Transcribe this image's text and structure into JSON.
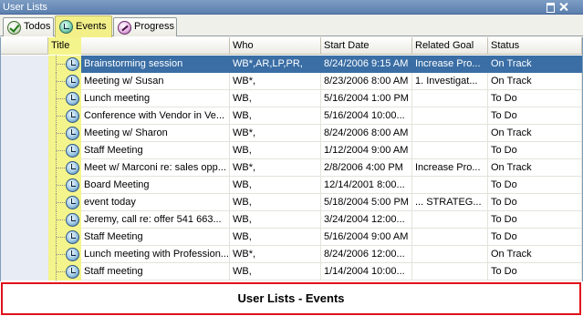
{
  "window": {
    "title": "User Lists"
  },
  "tabs": [
    {
      "label": "Todos",
      "icon": "check-icon"
    },
    {
      "label": "Events",
      "icon": "clock-icon",
      "active": true
    },
    {
      "label": "Progress",
      "icon": "progress-icon"
    }
  ],
  "columns": {
    "title": "Title",
    "who": "Who",
    "start": "Start Date",
    "goal": "Related Goal",
    "status": "Status"
  },
  "rows": [
    {
      "title": "Brainstorming session",
      "who": "WB*,AR,LP,PR,",
      "start": "8/24/2006 9:15 AM",
      "goal": "Increase Pro...",
      "status": "On Track",
      "selected": true
    },
    {
      "title": "Meeting w/ Susan",
      "who": "WB*,",
      "start": "8/23/2006 8:00 AM",
      "goal": "1. Investigat...",
      "status": "On Track"
    },
    {
      "title": "Lunch meeting",
      "who": "WB,",
      "start": "5/16/2004 1:00 PM",
      "goal": "",
      "status": "To Do"
    },
    {
      "title": "Conference with Vendor in Ve...",
      "who": "WB,",
      "start": "5/16/2004 10:00...",
      "goal": "",
      "status": "To Do"
    },
    {
      "title": "Meeting w/ Sharon",
      "who": "WB*,",
      "start": "8/24/2006 8:00 AM",
      "goal": "",
      "status": "On Track"
    },
    {
      "title": "Staff Meeting",
      "who": "WB,",
      "start": "1/12/2004 9:00 AM",
      "goal": "",
      "status": "To Do"
    },
    {
      "title": "Meet w/ Marconi re: sales opp...",
      "who": "WB*,",
      "start": "2/8/2006 4:00 PM",
      "goal": "Increase Pro...",
      "status": "On Track"
    },
    {
      "title": "Board Meeting",
      "who": "WB,",
      "start": "12/14/2001 8:00...",
      "goal": "",
      "status": "To Do"
    },
    {
      "title": "event today",
      "who": "WB,",
      "start": "5/18/2004 5:00 PM",
      "goal": "... STRATEG...",
      "status": "To Do"
    },
    {
      "title": "Jeremy, call re: offer 541 663...",
      "who": "WB,",
      "start": "3/24/2004 12:00...",
      "goal": "",
      "status": "To Do"
    },
    {
      "title": "Staff Meeting",
      "who": "WB,",
      "start": "5/16/2004 9:00 AM",
      "goal": "",
      "status": "To Do"
    },
    {
      "title": "Lunch meeting with Profession...",
      "who": "WB*,",
      "start": "8/24/2006 12:00...",
      "goal": "",
      "status": "On Track"
    },
    {
      "title": "Staff meeting",
      "who": "WB,",
      "start": "1/14/2004 10:00...",
      "goal": "",
      "status": "To Do"
    }
  ],
  "caption": "User Lists - Events",
  "colors": {
    "selected_row": "#3a6ea5",
    "highlight": "#f4f48c",
    "caption_border": "#e0101a"
  }
}
